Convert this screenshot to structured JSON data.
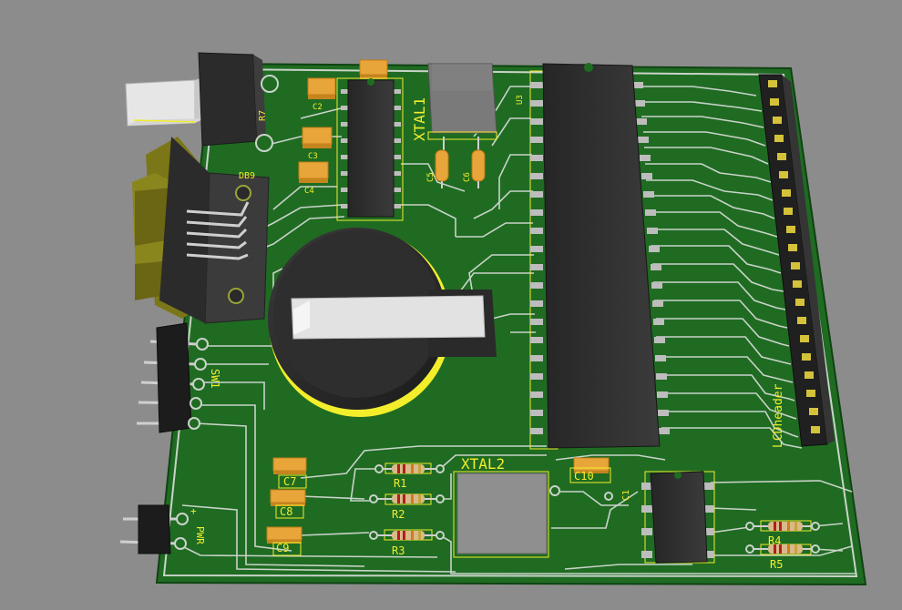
{
  "board": {
    "colors": {
      "background": "#8c8c8c",
      "pcb": "#1f6b22",
      "trace": "#c9d3c9",
      "silkscreen": "#f2ee2c",
      "ic_body": "#2f2f2f",
      "smd_cap": "#e8a53a"
    },
    "labels": {
      "r7": "R7",
      "c2": "C2",
      "c3": "C3",
      "c4": "C4",
      "c5": "C5",
      "c6": "C6",
      "c1_partial": "C1",
      "xtal1": "XTAL1",
      "xtal2": "XTAL2",
      "c10": "C10",
      "c7": "C7",
      "c8": "C8",
      "c9": "C9",
      "r1": "R1",
      "r2": "R2",
      "r3": "R3",
      "r4": "R4",
      "r5": "R5",
      "sw1": "SW1",
      "pwr": "PWR",
      "plus": "+",
      "lcd_header": "LCDheader",
      "u_partial": "U3",
      "db9_partial": "DB9"
    }
  }
}
